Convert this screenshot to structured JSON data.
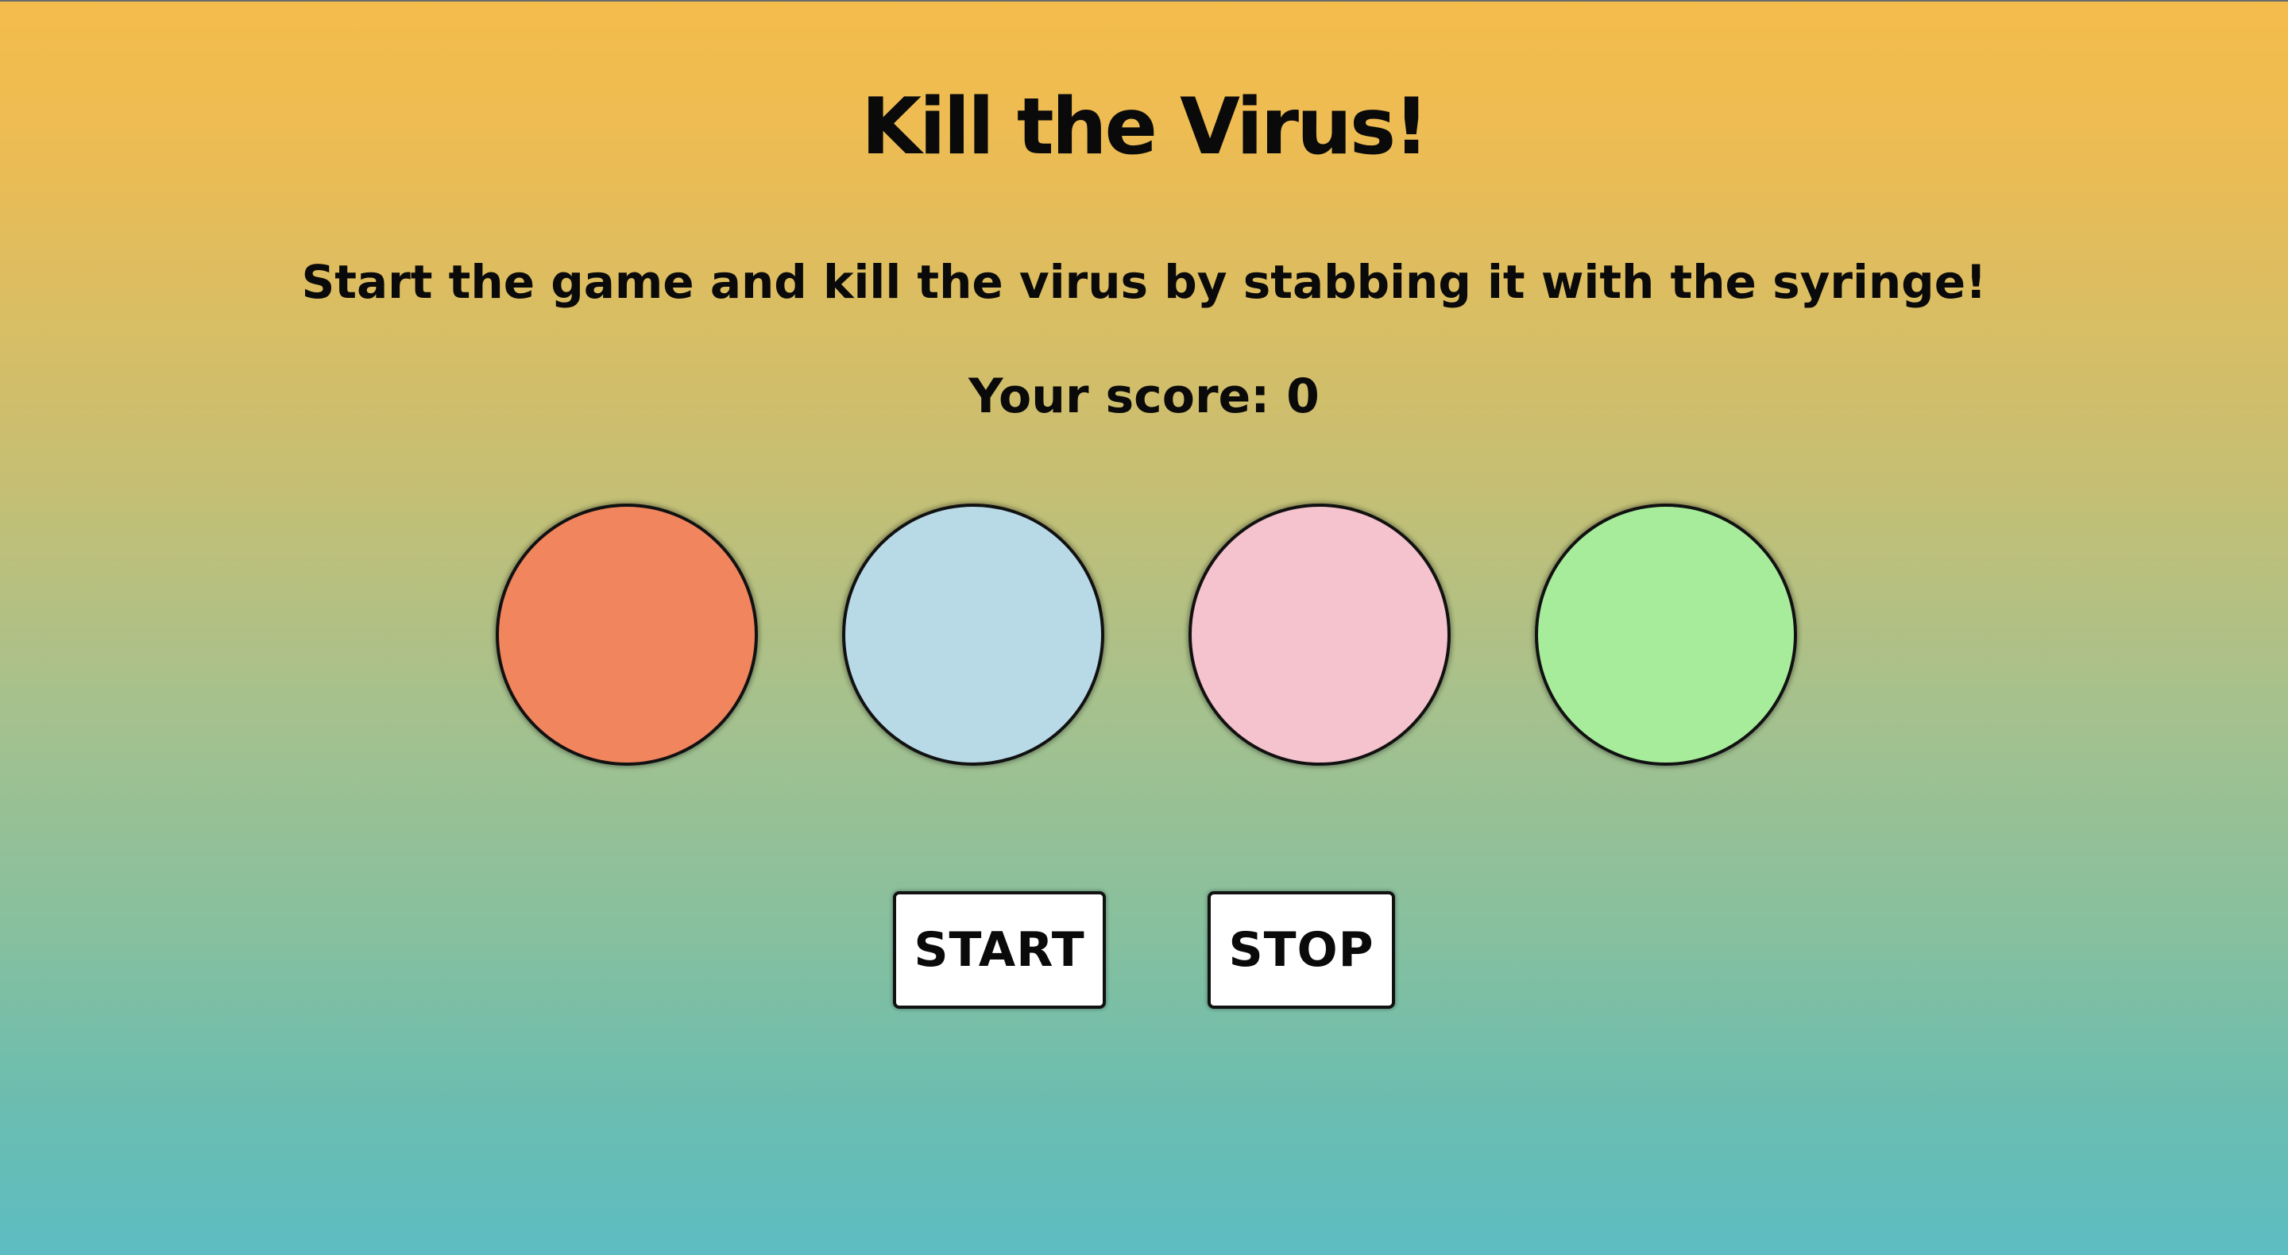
{
  "game": {
    "title": "Kill the Virus!",
    "instructions": "Start the game and kill the virus by stabbing it with the syringe!",
    "score_text": "Your score: 0",
    "score": 0
  },
  "holes": [
    {
      "id": 1,
      "color": "#f0855e"
    },
    {
      "id": 2,
      "color": "#b8d9e6"
    },
    {
      "id": 3,
      "color": "#f5c3cd"
    },
    {
      "id": 4,
      "color": "#a7ec9b"
    }
  ],
  "controls": {
    "start_label": "START",
    "stop_label": "STOP"
  },
  "colors": {
    "gradient_top": "#f4bc4b",
    "gradient_bottom": "#5dbdc2",
    "text": "#0a0a0a",
    "button_bg": "#ffffff"
  }
}
